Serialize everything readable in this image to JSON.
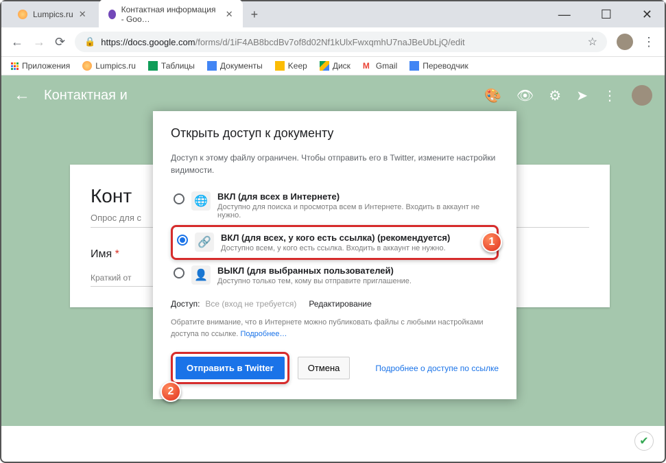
{
  "window": {
    "min": "—",
    "max": "☐",
    "close": "✕"
  },
  "tabs": {
    "t1": "Lumpics.ru",
    "t2": "Контактная информация - Goo…",
    "close": "✕",
    "new": "+"
  },
  "addr": {
    "back": "←",
    "fwd": "→",
    "reload": "⟳",
    "host": "https://docs.google.com",
    "path": "/forms/d/1iF4AB8bcdBv7of8d02Nf1kUlxFwxqmhU7naJBeUbLjQ/edit",
    "star": "☆"
  },
  "bookmarks": {
    "apps": "Приложения",
    "lumpics": "Lumpics.ru",
    "sheets": "Таблицы",
    "docs": "Документы",
    "keep": "Keep",
    "drive": "Диск",
    "gmail": "Gmail",
    "translate": "Переводчик"
  },
  "app": {
    "title": "Контактная и",
    "palette": "🎨",
    "view": "👁",
    "settings": "⚙",
    "send": "➤",
    "more": "⋮"
  },
  "form": {
    "title": "Конт",
    "desc": "Опрос для с",
    "field": "Имя",
    "req": "*",
    "hint": "Краткий от"
  },
  "modal": {
    "title": "Открыть доступ к документу",
    "sub": "Доступ к этому файлу ограничен. Чтобы отправить его в Twitter, измените настройки видимости.",
    "opt1": {
      "title": "ВКЛ (для всех в Интернете)",
      "desc": "Доступно для поиска и просмотра всем в Интернете. Входить в аккаунт не нужно."
    },
    "opt2": {
      "title": "ВКЛ (для всех, у кого есть ссылка) (рекомендуется)",
      "desc": "Доступно всем, у кого есть ссылка. Входить в аккаунт не нужно."
    },
    "opt3": {
      "title": "ВЫКЛ (для выбранных пользователей)",
      "desc": "Доступно только тем, кому вы отправите приглашение."
    },
    "access_label": "Доступ:",
    "access_val": "Все (вход не требуется)",
    "access_edit": "Редактирование",
    "note_text": "Обратите внимание, что в Интернете можно публиковать файлы с любыми настройками доступа по ссылке. ",
    "note_link": "Подробнее…",
    "btn_primary": "Отправить в Twitter",
    "btn_cancel": "Отмена",
    "more_link": "Подробнее о доступе по ссылке"
  },
  "callouts": {
    "c1": "1",
    "c2": "2"
  }
}
